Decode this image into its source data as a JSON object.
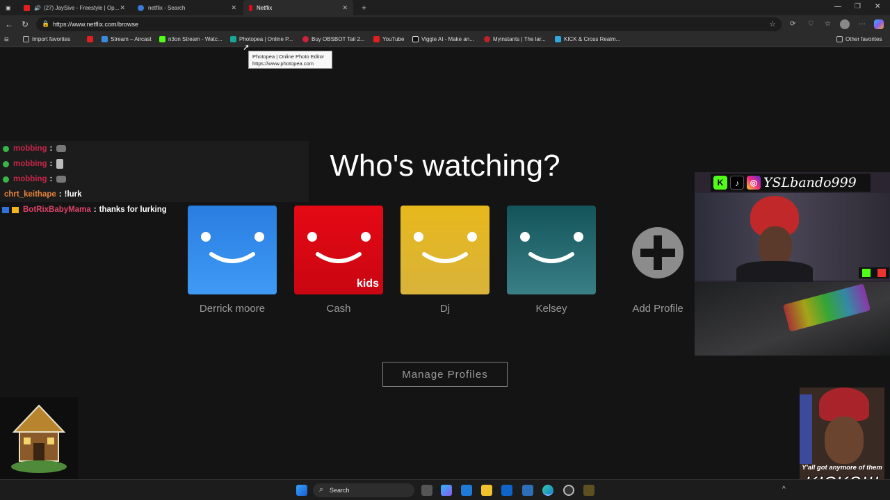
{
  "browser": {
    "tabs": [
      {
        "label": "(27) JaySive - Freestyle | Op..."
      },
      {
        "label": "netflix - Search"
      },
      {
        "label": "Netflix"
      }
    ],
    "url": "https://www.netflix.com/browse",
    "bookmarks": [
      {
        "label": "Import favorites"
      },
      {
        "label": ""
      },
      {
        "label": "Stream – Aircast"
      },
      {
        "label": "n3on Stream - Watc..."
      },
      {
        "label": "Photopea | Online P..."
      },
      {
        "label": "Buy OBSBOT Tail 2..."
      },
      {
        "label": "YouTube"
      },
      {
        "label": "Viggle AI - Make an..."
      },
      {
        "label": "Myinstants | The lar..."
      },
      {
        "label": "KICK & Cross Realm..."
      },
      {
        "label": "Other favorites"
      }
    ],
    "tooltip": {
      "line1": "Photopea | Online Photo Editor",
      "line2": "https://www.photopea.com"
    }
  },
  "netflix": {
    "heading": "Who's watching?",
    "profiles": [
      {
        "name": "Derrick moore",
        "color": "#2f8ef0"
      },
      {
        "name": "Cash",
        "color": "#e50914",
        "badge": "kids"
      },
      {
        "name": "Dj",
        "color": "#e7b81c"
      },
      {
        "name": "Kelsey",
        "color": "#1f5f66"
      }
    ],
    "add_profile": "Add Profile",
    "manage": "Manage Profiles"
  },
  "chat": [
    {
      "user": "mobbing",
      "sep": ":",
      "msg": "",
      "user_color": "#c7264a"
    },
    {
      "user": "mobbing",
      "sep": ":",
      "msg": "",
      "user_color": "#c7264a"
    },
    {
      "user": "mobbing",
      "sep": ":",
      "msg": "",
      "user_color": "#c7264a"
    },
    {
      "user": "chrt_keithape",
      "sep": ":",
      "msg": "!lurk",
      "user_color": "#e8833a"
    },
    {
      "user": "BotRixBabyMama",
      "sep": ":",
      "msg": "thanks for lurking",
      "user_color": "#e0436b"
    }
  ],
  "overlay": {
    "streamer_name": "YSLbando999",
    "meme_caption": "Y'all got anymore of them",
    "meme_big": "KICKS!!!"
  },
  "taskbar": {
    "search": "Search"
  }
}
